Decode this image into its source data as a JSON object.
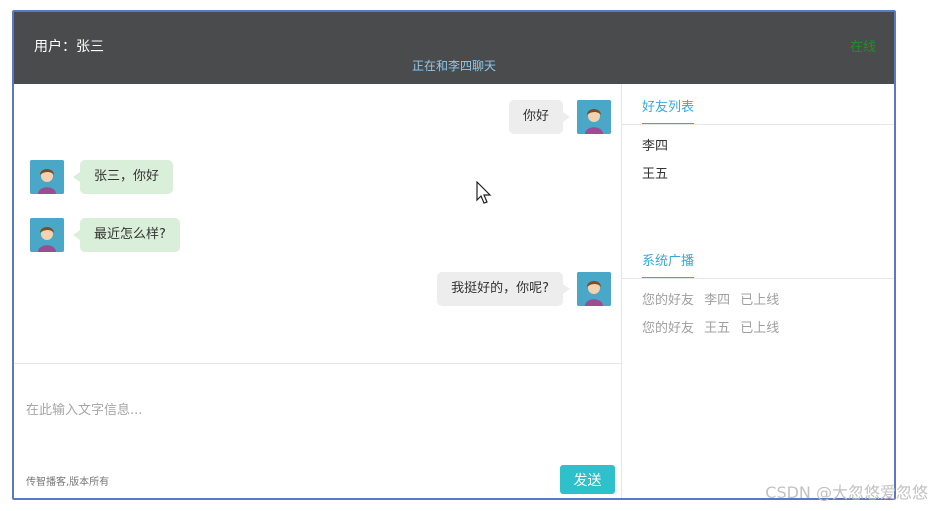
{
  "header": {
    "user_label": "用户：张三",
    "chat_with": "正在和李四聊天",
    "status": "在线",
    "status_color": "#1f8f2a"
  },
  "messages": [
    {
      "side": "me",
      "text": "你好"
    },
    {
      "side": "other",
      "text": "张三，你好"
    },
    {
      "side": "other",
      "text": "最近怎么样?"
    },
    {
      "side": "me",
      "text": "我挺好的，你呢?"
    }
  ],
  "input": {
    "placeholder": "在此输入文字信息..."
  },
  "footer": {
    "copyright": "传智播客,版本所有",
    "send_label": "发送"
  },
  "friends": {
    "title": "好友列表",
    "items": [
      "李四",
      "王五"
    ]
  },
  "broadcast": {
    "title": "系统广播",
    "items": [
      "您的好友 李四 已上线",
      "您的好友 王五 已上线"
    ]
  },
  "watermark": "CSDN @大忽悠爱忽悠",
  "colors": {
    "accent": "#3aa7d8",
    "send": "#2ec1cc",
    "header": "#4a4b4c",
    "bubble_me": "#ededed",
    "bubble_other": "#d9efd9"
  }
}
